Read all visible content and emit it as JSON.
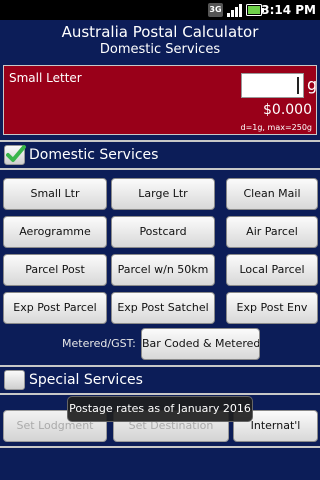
{
  "status_bar": {
    "network": "3G",
    "time": "3:14 PM"
  },
  "header": {
    "title": "Australia Postal Calculator",
    "subtitle": "Domestic Services"
  },
  "input_panel": {
    "label": "Small Letter",
    "weight_value": "",
    "unit": "g",
    "price": "$0.000",
    "range_note": "d=1g, max=250g",
    "background_color": "#990019"
  },
  "domestic_section": {
    "label": "Domestic Services",
    "checked": true,
    "buttons": [
      [
        "Small Ltr",
        "Large Ltr",
        "Clean Mail"
      ],
      [
        "Aerogramme",
        "Postcard",
        "Air Parcel"
      ],
      [
        "Parcel Post",
        "Parcel w/n 50km",
        "Local Parcel"
      ],
      [
        "Exp Post Parcel",
        "Exp Post Satchel",
        "Exp Post Env"
      ]
    ],
    "metered_label": "Metered/GST:",
    "metered_button": "Bar Coded & Metered"
  },
  "special_section": {
    "label": "Special Services",
    "checked": false,
    "buttons": [
      "Set Lodgment",
      "Set Destination",
      "Internat'l"
    ]
  },
  "toast": "Postage rates as of January 2016",
  "colors": {
    "background": "#0c1d58",
    "accent_check": "#39b54a"
  }
}
